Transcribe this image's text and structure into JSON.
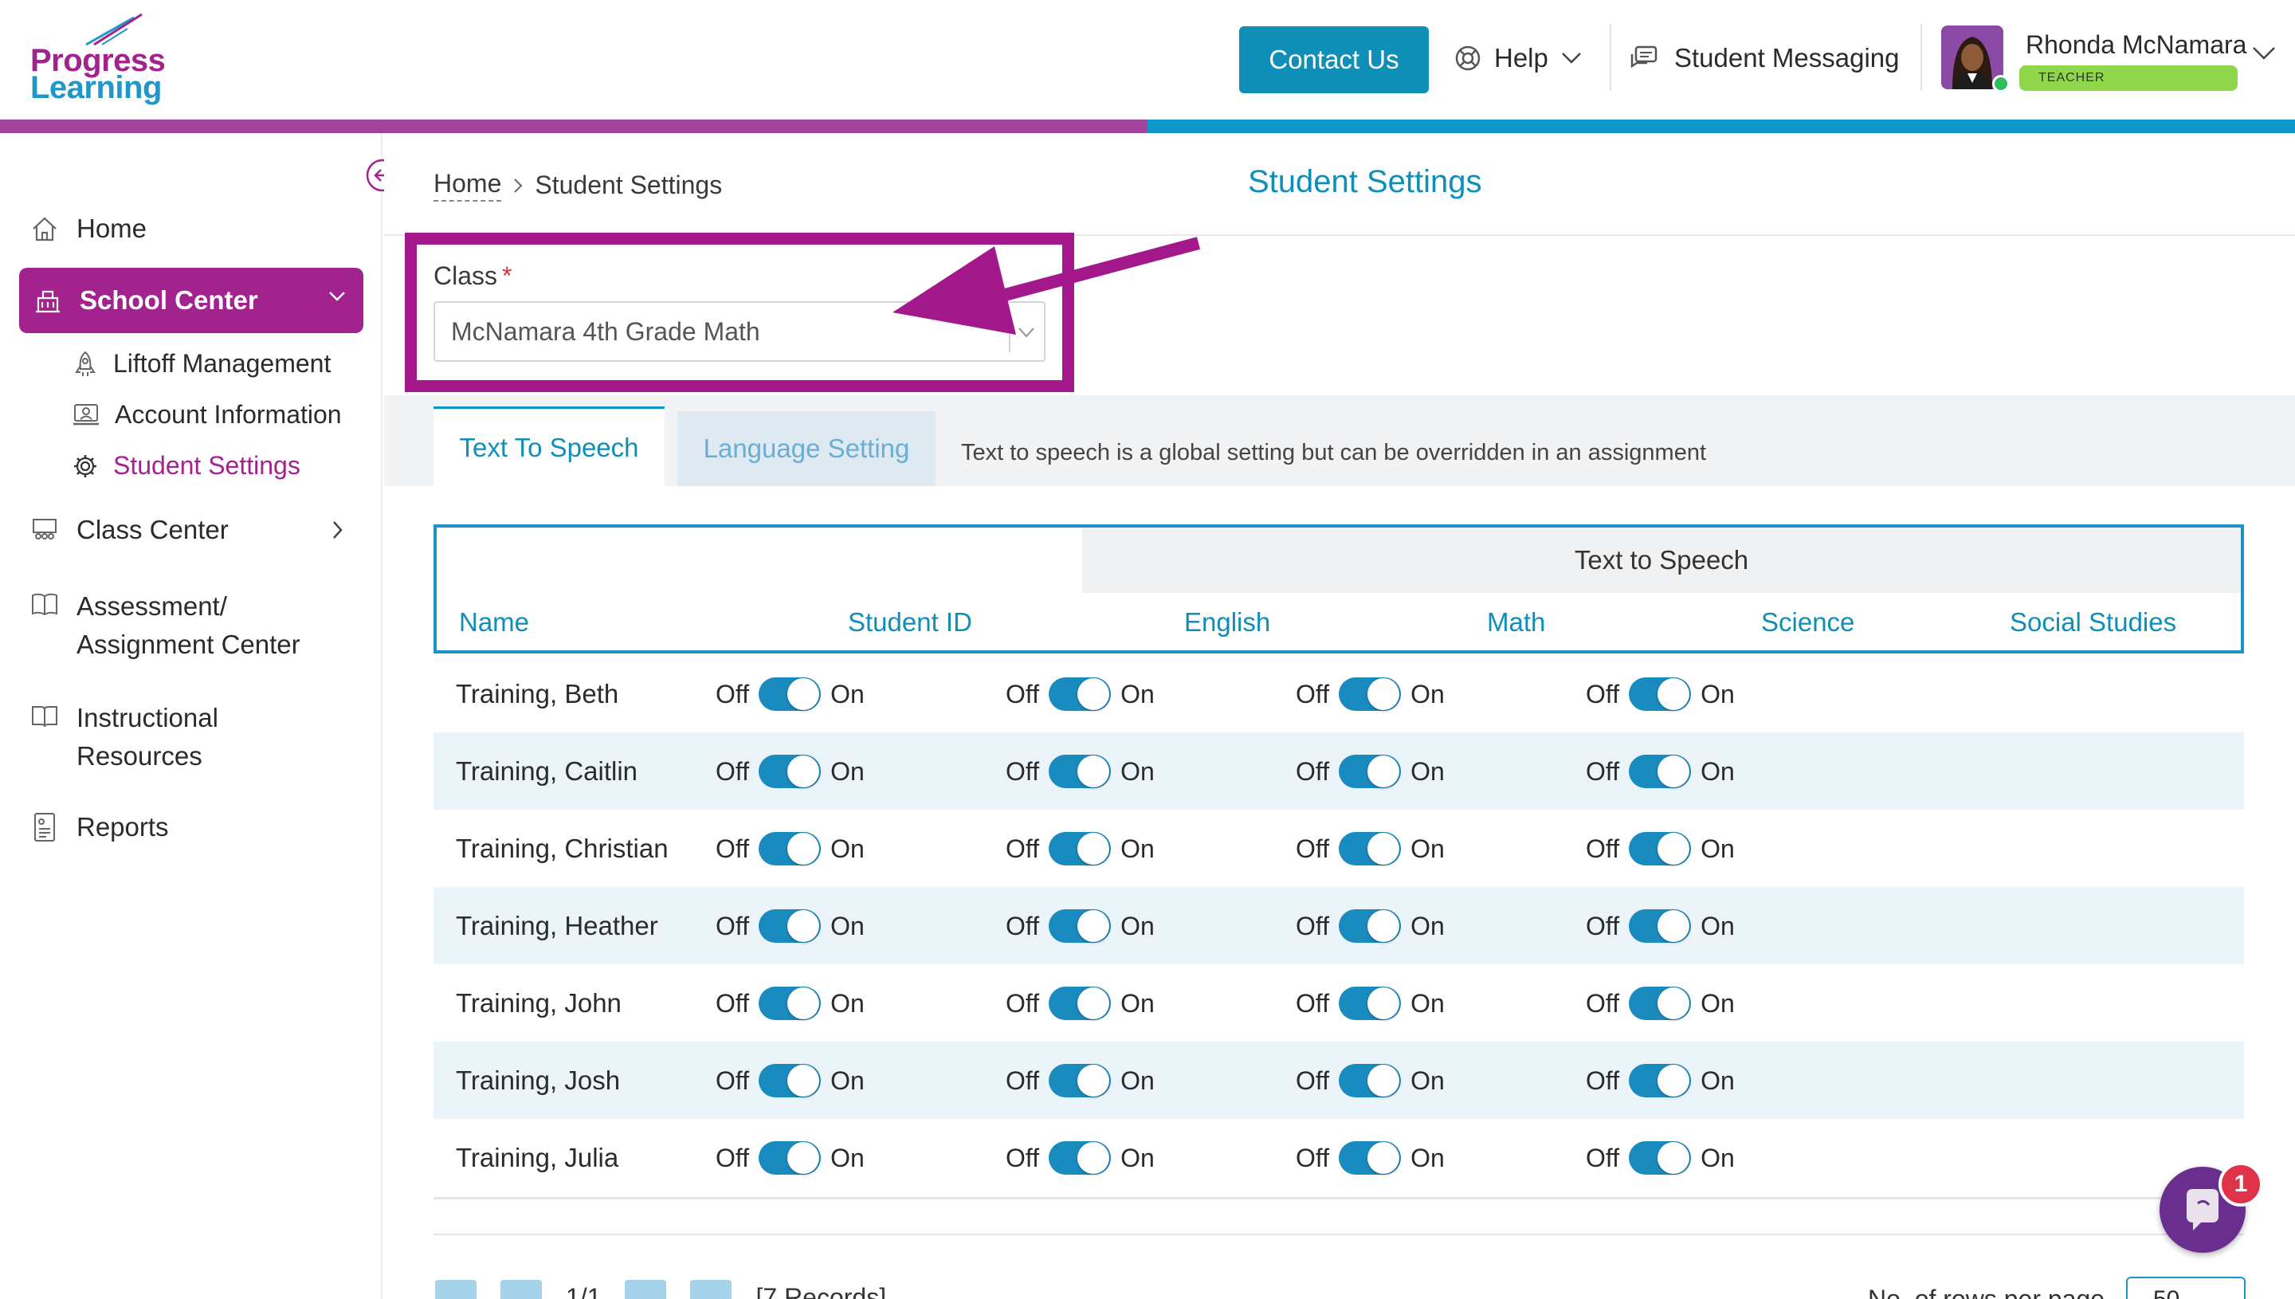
{
  "header": {
    "logo_line1": "Progress",
    "logo_line2": "Learning",
    "contact_label": "Contact Us",
    "help_label": "Help",
    "messaging_label": "Student Messaging",
    "user_name": "Rhonda McNamara",
    "user_role": "TEACHER"
  },
  "sidebar": {
    "items": [
      {
        "label": "Home",
        "icon": "home-icon"
      },
      {
        "label": "School Center",
        "icon": "school-icon"
      },
      {
        "label": "Class Center",
        "icon": "class-icon"
      },
      {
        "label": "Assessment/",
        "label2": "Assignment Center",
        "icon": "book-icon"
      },
      {
        "label": "Instructional",
        "label2": "Resources",
        "icon": "open-book-icon"
      },
      {
        "label": "Reports",
        "icon": "report-icon"
      }
    ],
    "sub_items": [
      {
        "label": "Liftoff Management",
        "icon": "rocket-icon"
      },
      {
        "label": "Account Information",
        "icon": "account-icon"
      },
      {
        "label": "Student Settings",
        "icon": "gear-icon"
      }
    ]
  },
  "breadcrumb": {
    "home": "Home",
    "current": "Student Settings"
  },
  "page_title": "Student Settings",
  "class_field": {
    "label": "Class",
    "required": "*",
    "value": "McNamara 4th Grade Math"
  },
  "tabs": {
    "tts": "Text To Speech",
    "language": "Language Setting",
    "note": "Text to speech is a global setting but can be overridden in an assignment"
  },
  "table": {
    "group_header": "Text to Speech",
    "columns": [
      "Name",
      "Student ID",
      "English",
      "Math",
      "Science",
      "Social Studies"
    ],
    "off_label": "Off",
    "on_label": "On",
    "rows": [
      {
        "name": "Training, Beth"
      },
      {
        "name": "Training, Caitlin"
      },
      {
        "name": "Training, Christian"
      },
      {
        "name": "Training, Heather"
      },
      {
        "name": "Training, John"
      },
      {
        "name": "Training, Josh"
      },
      {
        "name": "Training, Julia"
      }
    ]
  },
  "pager": {
    "page": "1/1",
    "records": "[7 Records]",
    "rows_label": "No. of rows per page",
    "rows_value": "50"
  },
  "chat": {
    "badge": "1"
  },
  "colors": {
    "brand_magenta": "#a3238e",
    "brand_blue": "#0f8fb8",
    "toggle": "#1a8bbf"
  }
}
